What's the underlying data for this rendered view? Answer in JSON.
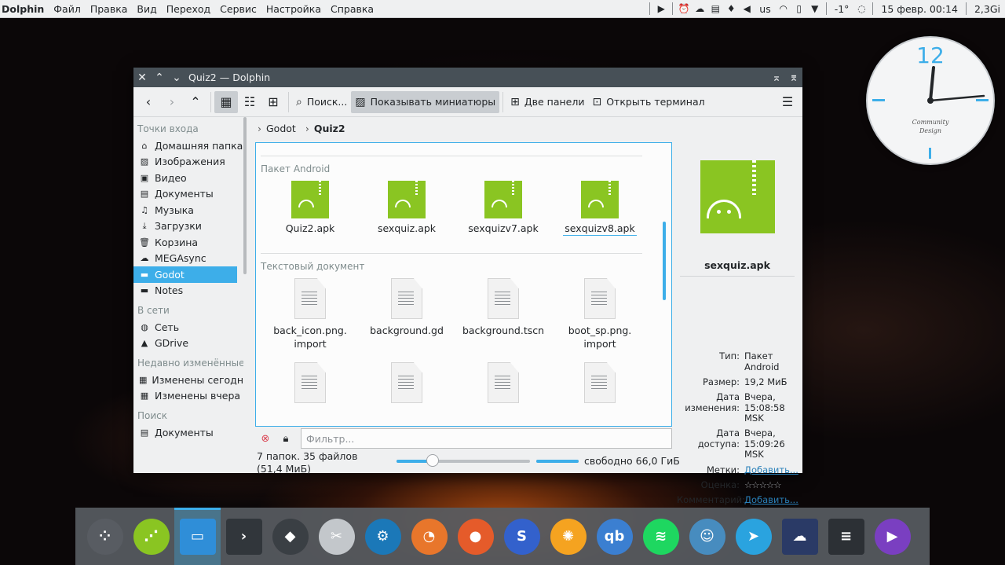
{
  "top_panel": {
    "app_name": "Dolphin",
    "menus": [
      "Файл",
      "Правка",
      "Вид",
      "Переход",
      "Сервис",
      "Настройка",
      "Справка"
    ],
    "keyboard_layout": "us",
    "temperature": "-1°",
    "datetime": "15 февр. 00:14",
    "memory": "2,3Gi"
  },
  "clock": {
    "hour_label": "12",
    "brand_line1": "Community",
    "brand_line2": "Design"
  },
  "window": {
    "title": "Quiz2 — Dolphin"
  },
  "toolbar": {
    "search_label": "Поиск...",
    "thumbnails_label": "Показывать миниатюры",
    "split_label": "Две панели",
    "terminal_label": "Открыть терминал"
  },
  "sidebar": {
    "sections": [
      {
        "title": "Точки входа",
        "items": [
          {
            "label": "Домашняя папка",
            "icon": "home-icon"
          },
          {
            "label": "Изображения",
            "icon": "image-icon"
          },
          {
            "label": "Видео",
            "icon": "video-icon"
          },
          {
            "label": "Документы",
            "icon": "documents-icon"
          },
          {
            "label": "Музыка",
            "icon": "music-icon"
          },
          {
            "label": "Загрузки",
            "icon": "download-icon"
          },
          {
            "label": "Корзина",
            "icon": "trash-icon"
          },
          {
            "label": "MEGAsync",
            "icon": "cloud-icon"
          },
          {
            "label": "Godot",
            "icon": "folder-icon",
            "selected": true
          },
          {
            "label": "Notes",
            "icon": "folder-icon"
          }
        ]
      },
      {
        "title": "В сети",
        "items": [
          {
            "label": "Сеть",
            "icon": "network-icon"
          },
          {
            "label": "GDrive",
            "icon": "gdrive-icon"
          }
        ]
      },
      {
        "title": "Недавно изменённые",
        "items": [
          {
            "label": "Изменены сегодня",
            "icon": "calendar-icon"
          },
          {
            "label": "Изменены вчера",
            "icon": "calendar-icon"
          }
        ]
      },
      {
        "title": "Поиск",
        "items": [
          {
            "label": "Документы",
            "icon": "documents-icon"
          }
        ]
      }
    ]
  },
  "breadcrumb": {
    "items": [
      "Godot",
      "Quiz2"
    ]
  },
  "file_view": {
    "groups": [
      {
        "title": "Пакет Android",
        "kind": "apk",
        "files": [
          "Quiz2.apk",
          "sexquiz.apk",
          "sexquizv7.apk",
          "sexquizv8.apk"
        ]
      },
      {
        "title": "Текстовый документ",
        "kind": "doc",
        "files": [
          "back_icon.png.\nimport",
          "background.gd",
          "background.tscn",
          "boot_sp.png.\nimport",
          "",
          "",
          "",
          ""
        ]
      }
    ]
  },
  "filter": {
    "placeholder": "Фильтр..."
  },
  "status": {
    "count": "7 папок. 35 файлов (51,4 МиБ)",
    "zoom_level": 0.27,
    "disk_used_fraction": 1.0,
    "free_space": "свободно 66,0 ГиБ"
  },
  "info_panel": {
    "file_name": "sexquiz.apk",
    "rows": [
      {
        "key": "Тип:",
        "value": "Пакет Android"
      },
      {
        "key": "Размер:",
        "value": "19,2 МиБ"
      },
      {
        "key": "Дата изменения:",
        "value": "Вчера, 15:08:58 MSK"
      },
      {
        "key": "Дата доступа:",
        "value": "Вчера, 15:09:26 MSK"
      },
      {
        "key": "Метки:",
        "value": "Добавить...",
        "link": true
      },
      {
        "key": "Оценка:",
        "value": "☆☆☆☆☆",
        "stars": true
      },
      {
        "key": "Комментарий:",
        "value": "Добавить...",
        "link": true
      }
    ]
  },
  "dock": {
    "apps": [
      {
        "name": "app-launcher-icon",
        "color": "#585c62",
        "glyph": "⁘"
      },
      {
        "name": "godot-path-icon",
        "color": "#8ac522",
        "glyph": "⋰"
      },
      {
        "name": "dolphin-icon",
        "color": "#2f8ed8",
        "glyph": "▭",
        "active": true
      },
      {
        "name": "terminal-icon",
        "color": "#31363b",
        "glyph": "›"
      },
      {
        "name": "krita-icon",
        "color": "#3a3f44",
        "glyph": "◆"
      },
      {
        "name": "kdenlive-icon",
        "color": "#c3c7cb",
        "glyph": "✂"
      },
      {
        "name": "steam-icon",
        "color": "#1b78b8",
        "glyph": "⚙"
      },
      {
        "name": "blender-icon",
        "color": "#e8762b",
        "glyph": "◔"
      },
      {
        "name": "firefox-icon",
        "color": "#e55b2a",
        "glyph": "●"
      },
      {
        "name": "simplenote-icon",
        "color": "#3361cc",
        "glyph": "S"
      },
      {
        "name": "orange-icon",
        "color": "#f5a320",
        "glyph": "✺"
      },
      {
        "name": "qbittorrent-icon",
        "color": "#3b7fd1",
        "glyph": "qb"
      },
      {
        "name": "spotify-icon",
        "color": "#1ed760",
        "glyph": "≋"
      },
      {
        "name": "godot-icon",
        "color": "#478cbf",
        "glyph": "☺"
      },
      {
        "name": "telegram-icon",
        "color": "#2aa3df",
        "glyph": "➤"
      },
      {
        "name": "megasync-icon",
        "color": "#2a3a66",
        "glyph": "☁"
      },
      {
        "name": "settings-icon",
        "color": "#2c3035",
        "glyph": "≡"
      },
      {
        "name": "media-player-icon",
        "color": "#7a3fc1",
        "glyph": "▶"
      }
    ]
  }
}
